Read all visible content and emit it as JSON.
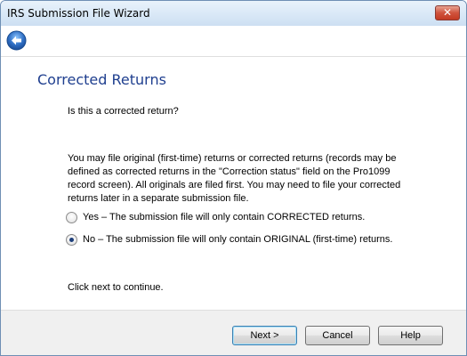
{
  "window": {
    "title": "IRS Submission File Wizard",
    "close_label": "✕"
  },
  "page": {
    "heading": "Corrected Returns",
    "question": "Is this a corrected return?",
    "explanation": "You may file original (first-time) returns or corrected returns (records may be defined as corrected returns in the \"Correction status\" field on the Pro1099 record screen). All originals are filed first. You may need to file your corrected returns later in a separate submission file.",
    "options": [
      {
        "label": "Yes – The submission file will only contain CORRECTED returns.",
        "checked": false
      },
      {
        "label": "No – The submission file will only contain ORIGINAL (first-time) returns.",
        "checked": true
      }
    ],
    "continue_text": "Click next to continue."
  },
  "buttons": {
    "next": "Next >",
    "cancel": "Cancel",
    "help": "Help"
  },
  "colors": {
    "heading": "#1f3f8f",
    "back_button": "#2f6fc4"
  },
  "icons": {
    "back": "back-arrow-icon"
  }
}
